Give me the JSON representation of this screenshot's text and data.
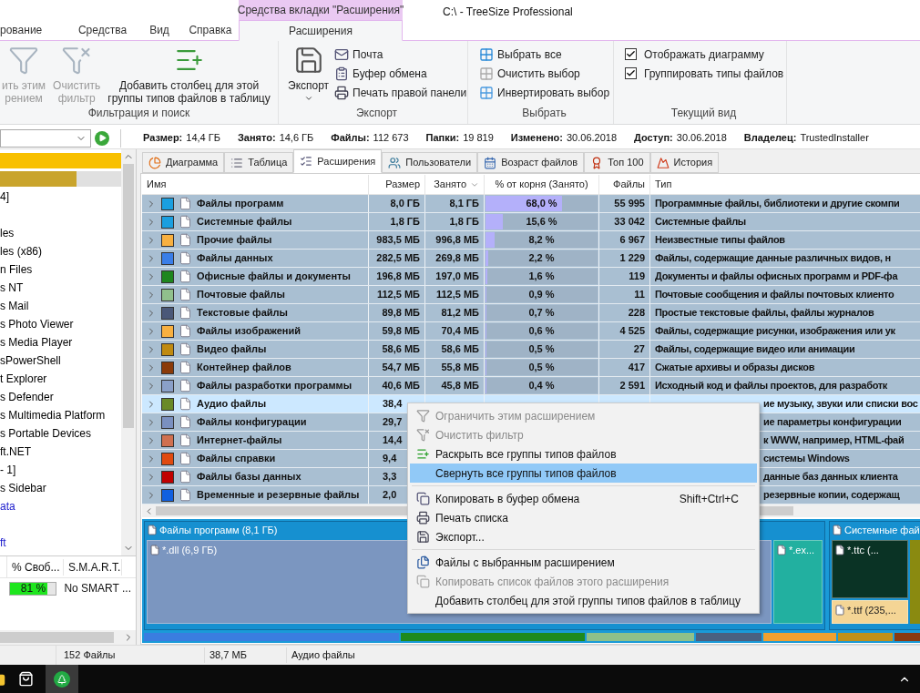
{
  "window": {
    "title": "C:\\ - TreeSize Professional",
    "context_tab_header": "Средства вкладки \"Расширения\""
  },
  "ribbon_tabs": [
    {
      "label": "рование",
      "selected": false
    },
    {
      "label": "Средства",
      "selected": false
    },
    {
      "label": "Вид",
      "selected": false
    },
    {
      "label": "Справка",
      "selected": false
    },
    {
      "label": "Расширения",
      "selected": true
    }
  ],
  "ribbon_groups": [
    {
      "title": "Фильтрация и поиск",
      "items": [
        {
          "kind": "large",
          "lines": [
            "ить этим",
            "рением"
          ],
          "disabled": true
        },
        {
          "kind": "large",
          "lines": [
            "Очистить",
            "фильтр"
          ],
          "disabled": true
        },
        {
          "kind": "large",
          "lines": [
            "Добавить столбец для этой",
            "группы типов файлов в таблицу"
          ],
          "disabled": false
        }
      ]
    },
    {
      "title": "Экспорт",
      "items": [
        {
          "kind": "split",
          "lines": [
            "Экспорт"
          ],
          "disabled": false
        },
        {
          "kind": "small",
          "label": "Почта",
          "disabled": false
        },
        {
          "kind": "small",
          "label": "Буфер обмена",
          "disabled": false
        },
        {
          "kind": "small",
          "label": "Печать правой панели",
          "disabled": false
        }
      ]
    },
    {
      "title": "Выбрать",
      "items": [
        {
          "kind": "small",
          "label": "Выбрать все",
          "disabled": false
        },
        {
          "kind": "small",
          "label": "Очистить выбор",
          "disabled": false
        },
        {
          "kind": "small",
          "label": "Инвертировать выбор",
          "disabled": false
        }
      ]
    },
    {
      "title": "Текущий вид",
      "items": [
        {
          "kind": "checkbox",
          "label": "Отображать диаграмму",
          "checked": true
        },
        {
          "kind": "checkbox",
          "label": "Группировать типы файлов",
          "checked": true
        }
      ]
    }
  ],
  "info_bar": [
    {
      "label": "Размер:",
      "value": "14,4 ГБ"
    },
    {
      "label": "Занято:",
      "value": "14,6 ГБ"
    },
    {
      "label": "Файлы:",
      "value": "112 673"
    },
    {
      "label": "Папки:",
      "value": "19 819"
    },
    {
      "label": "Изменено:",
      "value": "30.06.2018"
    },
    {
      "label": "Доступ:",
      "value": "30.06.2018"
    },
    {
      "label": "Владелец:",
      "value": "TrustedInstaller"
    }
  ],
  "tree": {
    "items": [
      {
        "kind": "bar",
        "level": 1,
        "color": "#f8c000"
      },
      {
        "kind": "bar",
        "level": 0.63,
        "color": "#c9a42c"
      },
      {
        "kind": "text",
        "text": "4]",
        "color": "#000000"
      },
      {
        "kind": "blank"
      },
      {
        "kind": "text",
        "text": "les",
        "color": "#000000"
      },
      {
        "kind": "text",
        "text": "les (x86)",
        "color": "#000000"
      },
      {
        "kind": "text",
        "text": "n Files",
        "color": "#000000"
      },
      {
        "kind": "text",
        "text": "s NT",
        "color": "#000000"
      },
      {
        "kind": "text",
        "text": "s Mail",
        "color": "#000000"
      },
      {
        "kind": "text",
        "text": "s Photo Viewer",
        "color": "#000000"
      },
      {
        "kind": "text",
        "text": "s Media Player",
        "color": "#000000"
      },
      {
        "kind": "text",
        "text": "sPowerShell",
        "color": "#000000"
      },
      {
        "kind": "text",
        "text": "t Explorer",
        "color": "#000000"
      },
      {
        "kind": "text",
        "text": "s Defender",
        "color": "#000000"
      },
      {
        "kind": "text",
        "text": "s Multimedia Platform",
        "color": "#000000"
      },
      {
        "kind": "text",
        "text": "s Portable Devices",
        "color": "#000000"
      },
      {
        "kind": "text",
        "text": "ft.NET",
        "color": "#000000"
      },
      {
        "kind": "text",
        "text": "- 1]",
        "color": "#000000"
      },
      {
        "kind": "text",
        "text": "s Sidebar",
        "color": "#000000"
      },
      {
        "kind": "text",
        "text": "ata",
        "color": "#1a1acc"
      },
      {
        "kind": "blank"
      },
      {
        "kind": "text",
        "text": "ft",
        "color": "#1a1acc"
      }
    ]
  },
  "drives": {
    "columns": [
      "% Своб...",
      "S.M.A.R.T."
    ],
    "rows": [
      {
        "free": "81 %",
        "level": 0.81,
        "smart": "No SMART ..."
      }
    ]
  },
  "view_tabs": [
    {
      "label": "Диаграмма",
      "selected": false
    },
    {
      "label": "Таблица",
      "selected": false
    },
    {
      "label": "Расширения",
      "selected": true
    },
    {
      "label": "Пользователи",
      "selected": false
    },
    {
      "label": "Возраст файлов",
      "selected": false
    },
    {
      "label": "Топ 100",
      "selected": false
    },
    {
      "label": "История",
      "selected": false
    }
  ],
  "table": {
    "columns": [
      {
        "label": "Имя",
        "sorted": false
      },
      {
        "label": "Размер",
        "sorted": false
      },
      {
        "label": "Занято",
        "sorted": true
      },
      {
        "label": "% от корня (Занято)",
        "sorted": false
      },
      {
        "label": "Файлы",
        "sorted": false
      },
      {
        "label": "Тип",
        "sorted": false
      }
    ],
    "rows": [
      {
        "kind": "full",
        "name": "Файлы программ",
        "color": "#1a9fe0",
        "size": "8,0 ГБ",
        "used": "8,1 ГБ",
        "pct": "68,0 %",
        "level": 0.68,
        "files": "55 995",
        "type": "Программные файлы, библиотеки и другие скомпи",
        "selected": false
      },
      {
        "kind": "full",
        "name": "Системные файлы",
        "color": "#1a9fe0",
        "size": "1,8 ГБ",
        "used": "1,8 ГБ",
        "pct": "15,6 %",
        "level": 0.156,
        "files": "33 042",
        "type": "Системные файлы",
        "selected": false
      },
      {
        "kind": "full",
        "name": "Прочие файлы",
        "color": "#f8b040",
        "size": "983,5 МБ",
        "used": "996,8 МБ",
        "pct": "8,2 %",
        "level": 0.082,
        "files": "6 967",
        "type": "Неизвестные типы файлов",
        "selected": false
      },
      {
        "kind": "full",
        "name": "Файлы данных",
        "color": "#3a7ee8",
        "size": "282,5 МБ",
        "used": "269,8 МБ",
        "pct": "2,2 %",
        "level": 0.022,
        "files": "1 229",
        "type": "Файлы, содержащие данные различных видов, н",
        "selected": false
      },
      {
        "kind": "full",
        "name": "Офисные файлы и документы",
        "color": "#1e861e",
        "size": "196,8 МБ",
        "used": "197,0 МБ",
        "pct": "1,6 %",
        "level": 0.016,
        "files": "119",
        "type": "Документы и файлы офисных программ и PDF-фа",
        "selected": false
      },
      {
        "kind": "full",
        "name": "Почтовые файлы",
        "color": "#90c08c",
        "size": "112,5 МБ",
        "used": "112,5 МБ",
        "pct": "0,9 %",
        "level": 0.009,
        "files": "11",
        "type": "Почтовые сообщения и файлы почтовых клиенто",
        "selected": false
      },
      {
        "kind": "full",
        "name": "Текстовые файлы",
        "color": "#4a5878",
        "size": "89,8 МБ",
        "used": "81,2 МБ",
        "pct": "0,7 %",
        "level": 0.007,
        "files": "228",
        "type": "Простые текстовые файлы, файлы журналов",
        "selected": false
      },
      {
        "kind": "full",
        "name": "Файлы изображений",
        "color": "#f8b040",
        "size": "59,8 МБ",
        "used": "70,4 МБ",
        "pct": "0,6 %",
        "level": 0.006,
        "files": "4 525",
        "type": "Файлы, содержащие рисунки, изображения или ук",
        "selected": false
      },
      {
        "kind": "full",
        "name": "Видео файлы",
        "color": "#c08a10",
        "size": "58,6 МБ",
        "used": "58,6 МБ",
        "pct": "0,5 %",
        "level": 0.005,
        "files": "27",
        "type": "Файлы, содержащие видео или анимации",
        "selected": false
      },
      {
        "kind": "full",
        "name": "Контейнер файлов",
        "color": "#8a3a08",
        "size": "54,7 МБ",
        "used": "55,8 МБ",
        "pct": "0,5 %",
        "level": 0.005,
        "files": "417",
        "type": "Сжатые архивы и образы дисков",
        "selected": false
      },
      {
        "kind": "full",
        "name": "Файлы разработки программы",
        "color": "#8aa0c8",
        "size": "40,6 МБ",
        "used": "45,8 МБ",
        "pct": "0,4 %",
        "level": 0.004,
        "files": "2 591",
        "type": "Исходный код и файлы проектов, для разработк",
        "selected": false
      },
      {
        "kind": "covered",
        "name": "Аудио файлы",
        "color": "#6a8a28",
        "size": "38,4",
        "type": "ие музыку, звуки или списки вос",
        "selected": true
      },
      {
        "kind": "covered",
        "name": "Файлы конфигурации",
        "color": "#7a90c0",
        "size": "29,7",
        "type": "ие параметры конфигурации",
        "selected": false
      },
      {
        "kind": "covered",
        "name": "Интернет-файлы",
        "color": "#d07050",
        "size": "14,4",
        "type": "к WWW, например, HTML-фай",
        "selected": false
      },
      {
        "kind": "covered",
        "name": "Файлы справки",
        "color": "#e04a10",
        "size": "9,4",
        "type": "системы Windows",
        "selected": false
      },
      {
        "kind": "covered",
        "name": "Файлы базы данных",
        "color": "#c00000",
        "size": "3,3",
        "type": "данные баз данных клиента",
        "selected": false
      },
      {
        "kind": "covered",
        "name": "Временные и резервные файлы",
        "color": "#1060e0",
        "size": "2,0",
        "type": "резервные копии, содержащ",
        "selected": false
      }
    ]
  },
  "treemap": {
    "groups": [
      {
        "label": "Файлы программ (8,1 ГБ)",
        "tiles": [
          {
            "label": "*.dll (6,9 ГБ)",
            "color": "#7b96c0"
          },
          {
            "label": "*.ex...",
            "color": "#22b0a0"
          }
        ]
      },
      {
        "label": "Системные фай",
        "tiles": [
          {
            "label": "*.ttc (...",
            "color": "#0a3325"
          },
          {
            "label": "*.ttf (235,...",
            "color": "#f4d595"
          }
        ]
      }
    ]
  },
  "context_menu": {
    "items": [
      {
        "kind": "item",
        "label": "Ограничить этим расширением",
        "disabled": true,
        "selected": false
      },
      {
        "kind": "item",
        "label": "Очистить фильтр",
        "disabled": true,
        "selected": false
      },
      {
        "kind": "item",
        "label": "Раскрыть все группы типов файлов",
        "disabled": false,
        "selected": false
      },
      {
        "kind": "item",
        "label": "Свернуть все группы типов файлов",
        "disabled": false,
        "selected": true
      },
      {
        "kind": "separator"
      },
      {
        "kind": "item",
        "label": "Копировать в буфер обмена",
        "shortcut": "Shift+Ctrl+C",
        "disabled": false,
        "selected": false
      },
      {
        "kind": "item",
        "label": "Печать списка",
        "disabled": false,
        "selected": false
      },
      {
        "kind": "item",
        "label": "Экспорт...",
        "disabled": false,
        "selected": false
      },
      {
        "kind": "separator"
      },
      {
        "kind": "item",
        "label": "Файлы с выбранным расширением",
        "disabled": false,
        "selected": false
      },
      {
        "kind": "item",
        "label": "Копировать список файлов этого расширения",
        "disabled": true,
        "selected": false
      },
      {
        "kind": "item",
        "label": "Добавить столбец для этой группы типов файлов в таблицу",
        "disabled": false,
        "selected": false
      }
    ]
  },
  "status_bar": {
    "files": "152 Файлы",
    "size": "38,7 МБ",
    "type": "Аудио файлы"
  }
}
